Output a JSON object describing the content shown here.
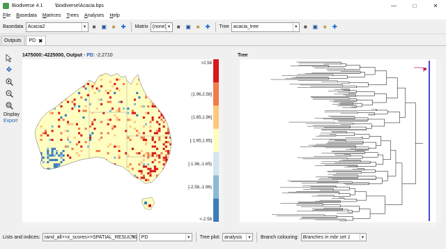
{
  "window": {
    "title": "Biodiverse 4.1         \\biodiverse\\Acacia.bps"
  },
  "menu": [
    "File",
    "Basedata",
    "Matrices",
    "Trees",
    "Analyses",
    "Help"
  ],
  "toolbar": {
    "basedata_label": "Basedata",
    "basedata_value": "Acacia2",
    "matrix_label": "Matrix",
    "matrix_value": "(none)",
    "tree_label": "Tree",
    "tree_value": "acacia_tree"
  },
  "tabs": [
    {
      "label": "Outputs",
      "active": false
    },
    {
      "label": "PD",
      "active": true,
      "closable": true
    }
  ],
  "left_tools": {
    "icons": [
      "pointer-icon",
      "pan-icon",
      "zoom-in-icon",
      "zoom-out-icon",
      "zoom-fit-icon"
    ],
    "display_label": "Display",
    "export_label": "Export"
  },
  "map_panel": {
    "coord": "1475000:-4225000, Output",
    "separator": " - ",
    "index_name": "PD",
    "index_value": ": -2.2710"
  },
  "legend": {
    "labels": [
      ">2.58",
      "(1.96,2.58]",
      "(1.65,1.96]",
      "[-1.65,1.65]",
      "[-1.96,-1.65)",
      "[-2.58,-1.96)",
      "<-2.58"
    ],
    "colors": [
      "#d7191c",
      "#f07c4a",
      "#fdc980",
      "#fffebe",
      "#d2e5ef",
      "#8bb9d8",
      "#3b7eb8"
    ]
  },
  "tree_panel": {
    "title": "Tree"
  },
  "bottom": {
    "lists_label": "Lists and indices:",
    "list_value": "rand_all>>z_scores>>SPATIAL_RESULTS",
    "index_value": "PD",
    "treeplot_label": "Tree plot:",
    "treeplot_value": "analysis",
    "branch_label": "Branch colouring:",
    "branch_value": "Branches in mbr set 1"
  }
}
